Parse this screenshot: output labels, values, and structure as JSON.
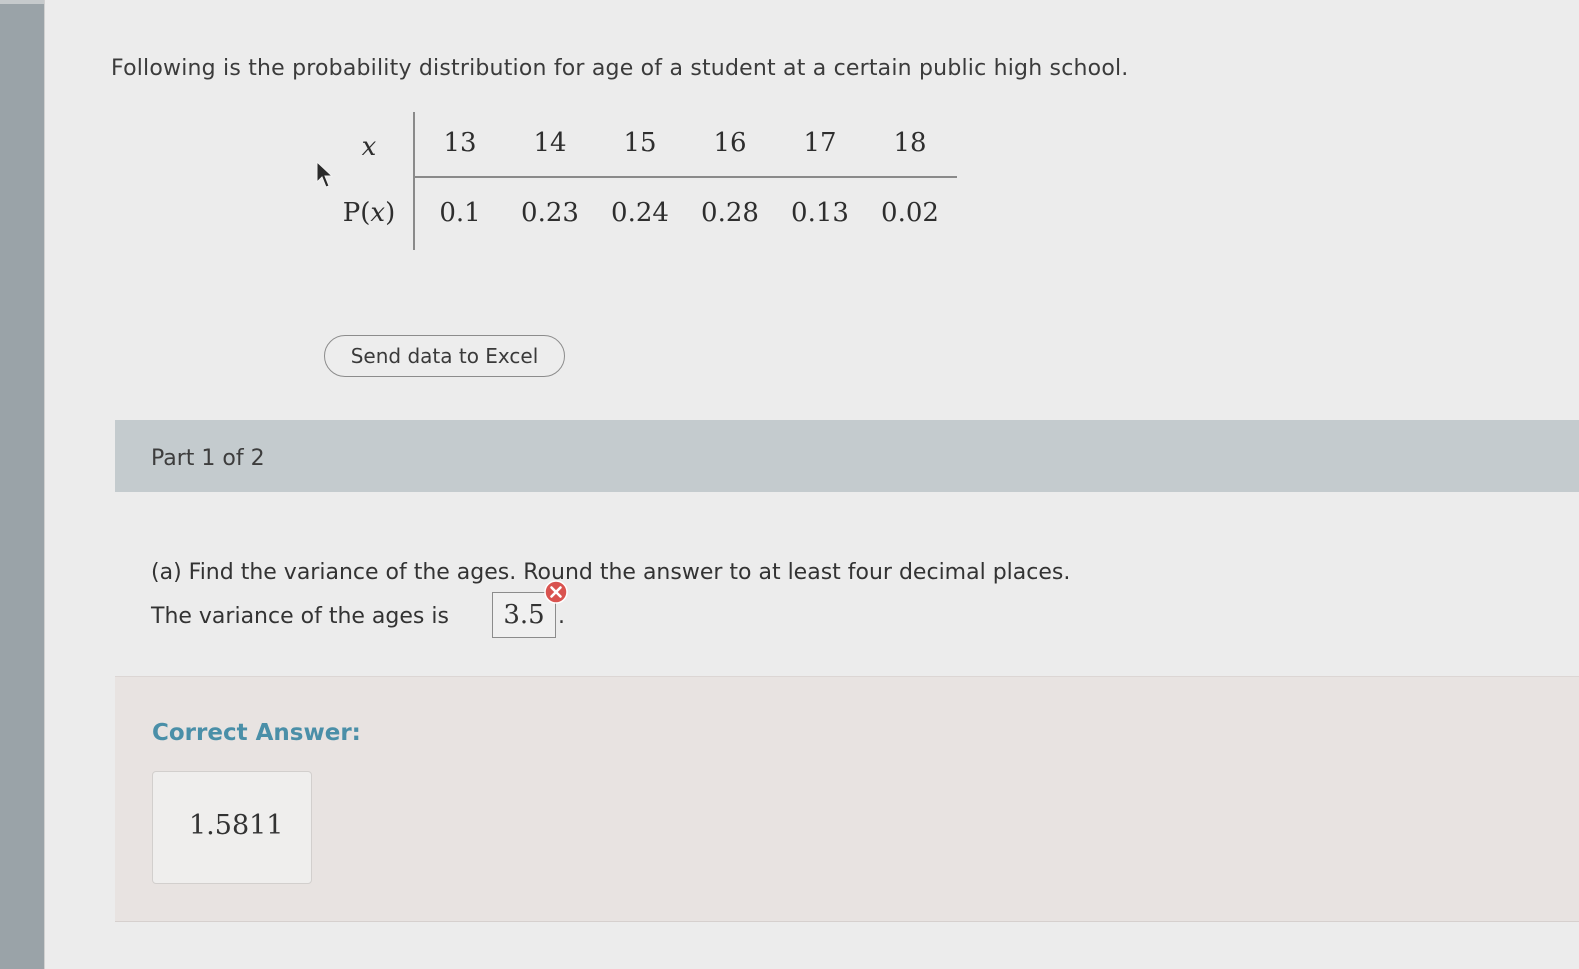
{
  "prompt": "Following is the probability distribution for age of a student at a certain public high school.",
  "table": {
    "x_label": "x",
    "px_label_prefix": "P",
    "px_label_var": "x",
    "x_values": [
      "13",
      "14",
      "15",
      "16",
      "17",
      "18"
    ],
    "p_values": [
      "0.1",
      "0.23",
      "0.24",
      "0.28",
      "0.13",
      "0.02"
    ]
  },
  "excel_button": "Send data to Excel",
  "part": {
    "header": "Part 1 of 2",
    "question": "(a) Find the variance of the ages. Round the answer to at least four decimal places.",
    "answer_prefix": "The variance of the ages is",
    "answer_value": "3.5",
    "answer_suffix": ".",
    "answer_status_icon": "incorrect-x-icon",
    "correct_label": "Correct Answer:",
    "correct_value": "1.5811"
  },
  "colors": {
    "part_header_bg": "#c4cbce",
    "correct_label": "#4a8fa8",
    "incorrect_icon": "#d9534f",
    "correct_panel_bg": "#e8e3e1"
  }
}
